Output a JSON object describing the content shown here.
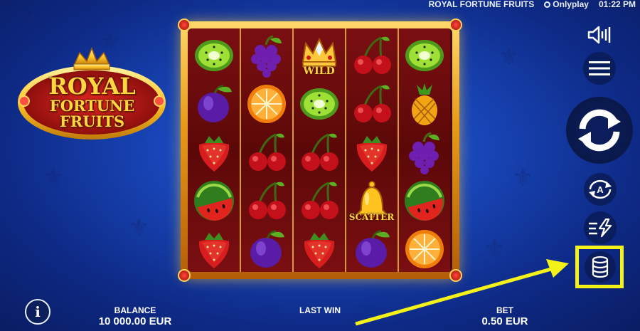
{
  "topbar": {
    "game_title": "ROYAL FORTUNE FRUITS",
    "provider": "Onlyplay",
    "time": "01:22 PM"
  },
  "logo": {
    "line1": "ROYAL",
    "line2": "FORTUNE",
    "line3": "FRUITS"
  },
  "reels": {
    "grid": [
      [
        "kiwi",
        "plum",
        "strawberry",
        "watermelon",
        "strawberry"
      ],
      [
        "grapes",
        "orange",
        "cherry",
        "cherry",
        "plum"
      ],
      [
        "wild",
        "kiwi",
        "cherry",
        "cherry",
        "strawberry"
      ],
      [
        "cherry",
        "cherry",
        "strawberry",
        "scatter",
        "plum"
      ],
      [
        "kiwi",
        "pineapple",
        "grapes",
        "watermelon",
        "orange"
      ]
    ],
    "wild_label": "WILD",
    "scatter_label": "SCATTER"
  },
  "controls": {
    "sound_icon": "speaker-icon",
    "menu_icon": "hamburger-icon",
    "spin_icon": "spin-arrows-icon",
    "autoplay_label": "A",
    "turbo_icon": "lightning-icon",
    "bet_icon": "coin-stack-icon",
    "highlight_color": "#f5f21a"
  },
  "footer": {
    "info_label": "i",
    "balance_label": "BALANCE",
    "balance_value": "10 000.00 EUR",
    "last_win_label": "LAST WIN",
    "last_win_value": "",
    "bet_label": "BET",
    "bet_value": "0.50 EUR"
  }
}
